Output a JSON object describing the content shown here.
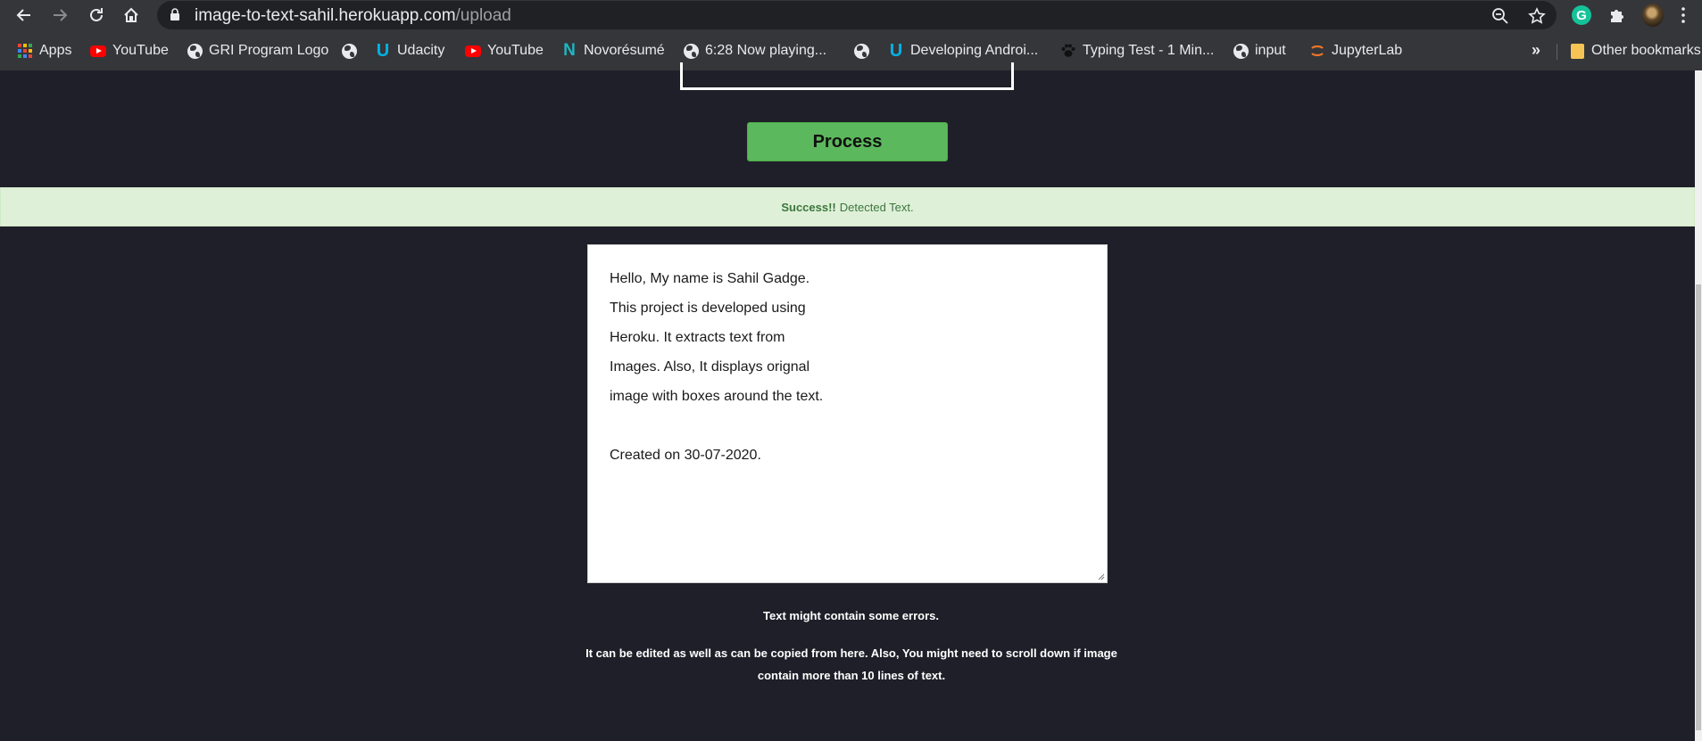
{
  "browser": {
    "url_host": "image-to-text-sahil.herokuapp.com",
    "url_path": "/upload",
    "icons": {
      "back": "arrow-left-icon",
      "forward": "arrow-right-icon",
      "reload": "reload-icon",
      "home": "home-icon",
      "lock": "lock-icon",
      "zoom": "zoom-out-icon",
      "bookmark_star": "star-icon",
      "grammarly": "grammarly-icon",
      "extensions": "puzzle-icon",
      "profile": "avatar"
    },
    "grammarly_letter": "G",
    "bookmarks": [
      {
        "label": "Apps",
        "icon": "apps-grid-icon"
      },
      {
        "label": "YouTube",
        "icon": "youtube-icon"
      },
      {
        "label": "GRI Program Logo",
        "icon": "globe-icon"
      },
      {
        "label": "",
        "icon": "globe-icon"
      },
      {
        "label": "Udacity",
        "icon": "udacity-icon"
      },
      {
        "label": "YouTube",
        "icon": "youtube-icon"
      },
      {
        "label": "Novorésumé",
        "icon": "novoresume-icon"
      },
      {
        "label": "6:28 Now playing...",
        "icon": "globe-icon"
      },
      {
        "label": "",
        "icon": "globe-icon"
      },
      {
        "label": "Developing Androi...",
        "icon": "udacity-icon"
      },
      {
        "label": "Typing Test - 1 Min...",
        "icon": "paw-icon"
      },
      {
        "label": "input",
        "icon": "globe-icon"
      },
      {
        "label": "JupyterLab",
        "icon": "jupyter-icon"
      }
    ],
    "more_bookmarks": "»",
    "other_bookmarks": "Other bookmarks"
  },
  "page": {
    "process_button": "Process",
    "alert": {
      "strong": "Success!!",
      "text": "Detected Text."
    },
    "detected_text": [
      "Hello, My name is Sahil Gadge.",
      "This project is developed using",
      "Heroku. It extracts text from",
      "Images. Also, It displays orignal",
      "image with boxes around the text.",
      "",
      "Created on 30-07-2020."
    ],
    "note1": "Text might contain some errors.",
    "note2": "It can be edited as well as can be copied from here. Also, You might need to scroll down if image contain more than 10 lines of text."
  },
  "colors": {
    "page_bg": "#1f1f29",
    "chrome_bg": "#35363a",
    "button_green": "#5cb85c",
    "alert_bg": "#dff0d8",
    "alert_text": "#3c763d"
  }
}
